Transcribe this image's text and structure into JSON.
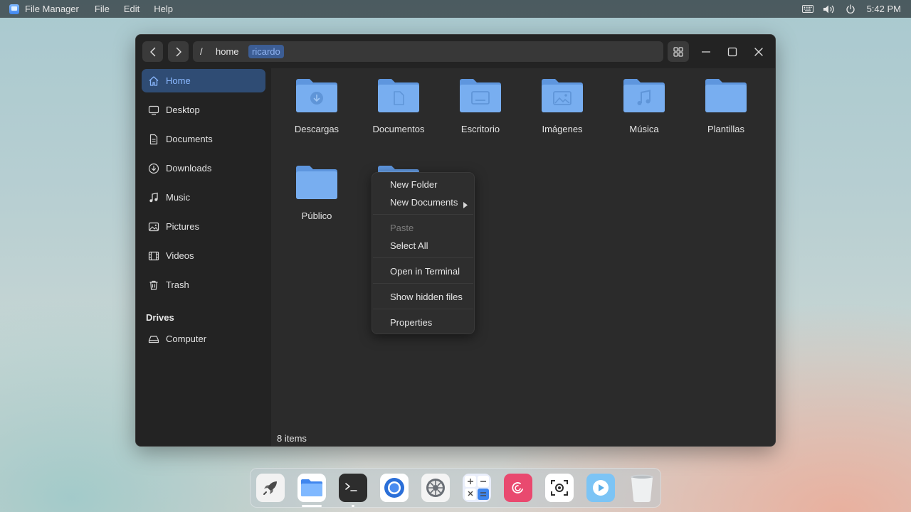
{
  "topbar": {
    "app_name": "File Manager",
    "menus": [
      "File",
      "Edit",
      "Help"
    ],
    "clock": "5:42 PM",
    "tray_icons": [
      "keyboard-icon",
      "volume-icon",
      "power-icon"
    ]
  },
  "window": {
    "breadcrumbs": [
      "/",
      "home",
      "ricardo"
    ],
    "active_crumb": "ricardo"
  },
  "sidebar": {
    "items": [
      {
        "label": "Home",
        "icon": "home-icon",
        "selected": true
      },
      {
        "label": "Desktop",
        "icon": "desktop-icon"
      },
      {
        "label": "Documents",
        "icon": "document-icon"
      },
      {
        "label": "Downloads",
        "icon": "download-icon"
      },
      {
        "label": "Music",
        "icon": "music-icon"
      },
      {
        "label": "Pictures",
        "icon": "picture-icon"
      },
      {
        "label": "Videos",
        "icon": "video-icon"
      },
      {
        "label": "Trash",
        "icon": "trash-icon"
      }
    ],
    "drives_heading": "Drives",
    "drives": [
      {
        "label": "Computer",
        "icon": "drive-icon"
      }
    ]
  },
  "main": {
    "folders": [
      {
        "name": "Descargas",
        "icon": "download-icon"
      },
      {
        "name": "Documentos",
        "icon": "document-icon"
      },
      {
        "name": "Escritorio",
        "icon": "desktop-icon"
      },
      {
        "name": "Imágenes",
        "icon": "picture-icon"
      },
      {
        "name": "Música",
        "icon": "music-icon"
      },
      {
        "name": "Plantillas",
        "icon": ""
      },
      {
        "name": "Público",
        "icon": ""
      },
      {
        "name": "",
        "icon": ""
      }
    ],
    "status": "8 items"
  },
  "context_menu": {
    "items": [
      {
        "label": "New Folder"
      },
      {
        "label": "New Documents",
        "submenu": true
      },
      {
        "label": "Paste",
        "disabled": true
      },
      {
        "label": "Select All"
      },
      {
        "label": "Open in Terminal"
      },
      {
        "label": "Show hidden files"
      },
      {
        "label": "Properties"
      }
    ]
  },
  "dock": {
    "apps": [
      "launcher-icon",
      "file-manager-icon",
      "terminal-icon",
      "browser-icon",
      "settings-icon",
      "calculator-icon",
      "debian-icon",
      "screenshot-icon",
      "media-player-icon",
      "trash-icon"
    ]
  },
  "colors": {
    "folder": "#78aef0",
    "folder_tab": "#5e96de",
    "accent": "#3c5d94"
  }
}
